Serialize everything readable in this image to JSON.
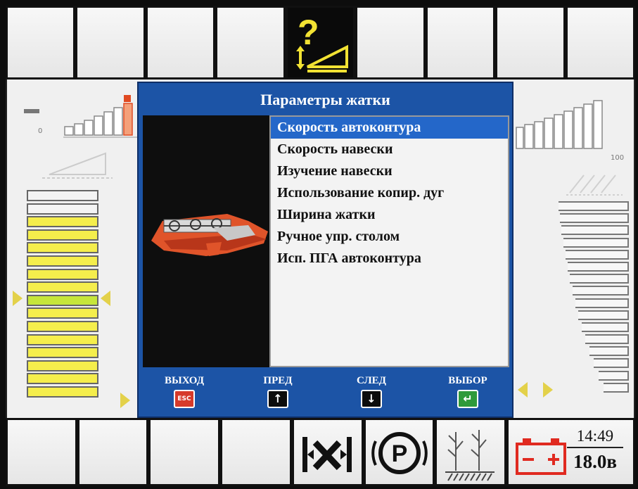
{
  "dialog": {
    "title": "Параметры жатки",
    "items": [
      {
        "label": "Скорость автоконтура",
        "selected": true
      },
      {
        "label": "Скорость навески",
        "selected": false
      },
      {
        "label": "Изучение навески",
        "selected": false
      },
      {
        "label": "Использование копир. дуг",
        "selected": false
      },
      {
        "label": "Ширина жатки",
        "selected": false
      },
      {
        "label": "Ручное упр. столом",
        "selected": false
      },
      {
        "label": "Исп. ПГА автоконтура",
        "selected": false
      }
    ],
    "footer": {
      "exit_label": "ВЫХОД",
      "exit_key": "ESC",
      "prev_label": "ПРЕД",
      "next_label": "СЛЕД",
      "select_label": "ВЫБОР"
    }
  },
  "gauges": {
    "left_min": "0",
    "right_max": "100"
  },
  "status": {
    "time": "14:49",
    "voltage": "18.0в"
  },
  "icons": {
    "top_active": "header-help-icon",
    "bottom": [
      "float-lock-icon",
      "parking-brake-icon",
      "crop-row-icon",
      "battery-icon"
    ]
  },
  "colors": {
    "dialog_blue": "#1c54a6",
    "selection_blue": "#2467c9",
    "indicator_yellow": "#f5ee4c",
    "indicator_green": "#c6e63a",
    "header_red": "#e04a22",
    "battery_red": "#e02a20"
  }
}
